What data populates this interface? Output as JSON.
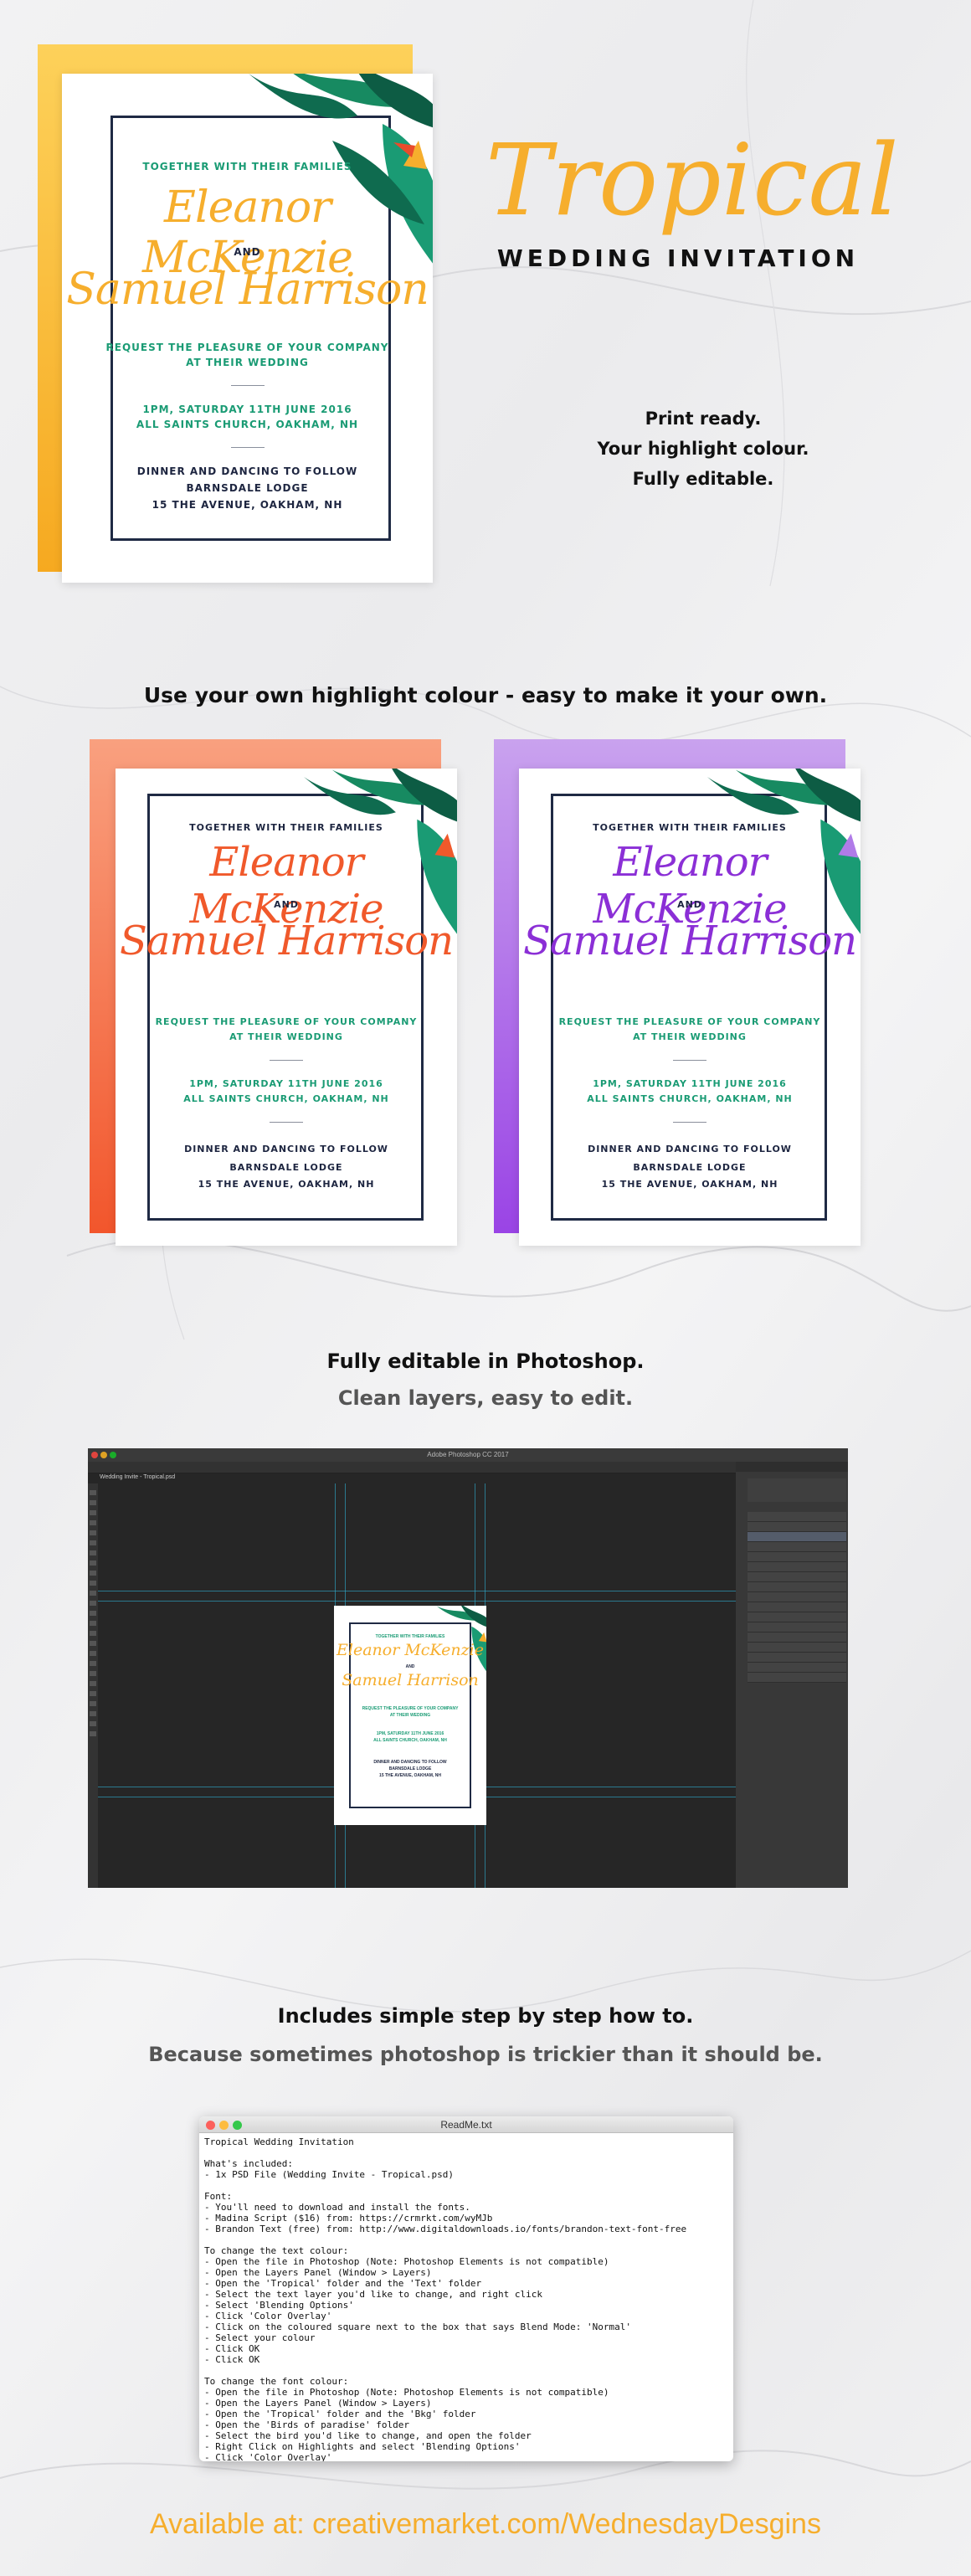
{
  "invitation": {
    "line1": "TOGETHER WITH THEIR FAMILIES",
    "name1": "Eleanor McKenzie",
    "and": "AND",
    "name2": "Samuel Harrison",
    "request1": "REQUEST THE PLEASURE OF YOUR COMPANY",
    "request2": "AT THEIR WEDDING",
    "date": "1PM, SATURDAY 11TH JUNE 2016",
    "church": "ALL SAINTS CHURCH, OAKHAM, NH",
    "dinner": "DINNER AND DANCING TO FOLLOW",
    "lodge": "BARNSDALE LODGE",
    "address": "15 THE AVENUE, OAKHAM, NH"
  },
  "hero": {
    "title_script": "Tropical",
    "subtitle": "WEDDING INVITATION",
    "features": [
      "Print ready.",
      "Your highlight colour.",
      "Fully editable."
    ]
  },
  "section2": {
    "heading": "Use your own highlight colour - easy to make it your own."
  },
  "section3": {
    "heading": "Fully editable in Photoshop.",
    "subheading": "Clean layers, easy to edit."
  },
  "photoshop": {
    "app_title": "Adobe Photoshop CC 2017",
    "doc_tab": "Wedding Invite - Tropical.psd"
  },
  "section4": {
    "heading": "Includes simple step by step how to.",
    "subheading": "Because sometimes photoshop is trickier than it should be."
  },
  "readme": {
    "window_title": "ReadMe.txt",
    "lines": [
      "Tropical Wedding Invitation",
      "",
      "What's included:",
      "- 1x PSD File (Wedding Invite - Tropical.psd)",
      "",
      "Font:",
      "- You'll need to download and install the fonts.",
      "- Madina Script ($16) from: https://crmrkt.com/wyMJb",
      "- Brandon Text (free) from: http://www.digitaldownloads.io/fonts/brandon-text-font-free",
      "",
      "To change the text colour:",
      "- Open the file in Photoshop (Note: Photoshop Elements is not compatible)",
      "- Open the Layers Panel (Window > Layers)",
      "- Open the 'Tropical' folder and the 'Text' folder",
      "- Select the text layer you'd like to change, and right click",
      "- Select 'Blending Options'",
      "- Click 'Color Overlay'",
      "- Click on the coloured square next to the box that says Blend Mode: 'Normal'",
      "- Select your colour",
      "- Click OK",
      "- Click OK",
      "",
      "To change the font colour:",
      "- Open the file in Photoshop (Note: Photoshop Elements is not compatible)",
      "- Open the Layers Panel (Window > Layers)",
      "- Open the 'Tropical' folder and the 'Bkg' folder",
      "- Open the 'Birds of paradise' folder",
      "- Select the bird you'd like to change, and open the folder",
      "- Right Click on Highlights and select 'Blending Options'",
      "- Click 'Color Overlay'"
    ]
  },
  "footer": {
    "text": "Available at: creativemarket.com/WednesdayDesgins"
  },
  "colors": {
    "orange": "#f6ae2d",
    "coral": "#f0592b",
    "purple": "#8b2fd6",
    "teal": "#1a9b74",
    "navy": "#1d2540"
  }
}
